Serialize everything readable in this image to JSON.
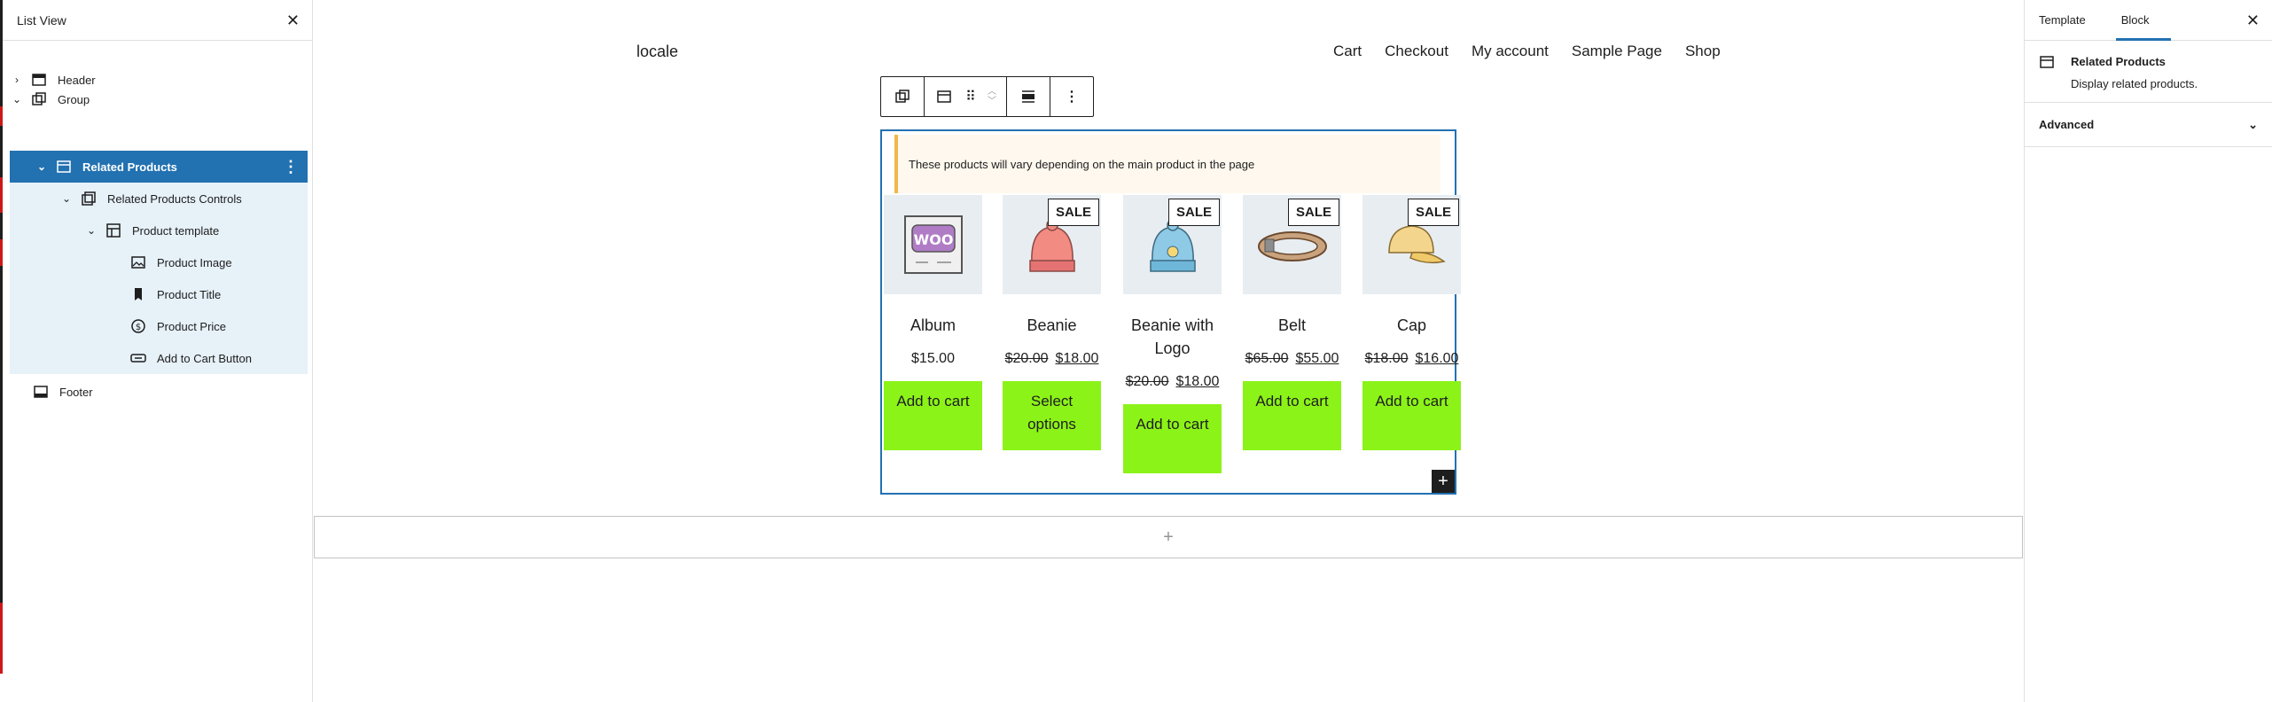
{
  "list_view": {
    "title": "List View",
    "close_icon": "close-icon",
    "items": [
      {
        "label": "Header",
        "icon": "template-part-icon",
        "chevron": "›"
      },
      {
        "label": "Group",
        "icon": "group-icon",
        "chevron": "⌄"
      },
      {
        "label": "Related Products",
        "icon": "related-products-icon",
        "chevron": "⌄"
      },
      {
        "label": "Related Products Controls",
        "icon": "controls-icon",
        "chevron": "⌄"
      },
      {
        "label": "Product template",
        "icon": "layout-icon",
        "chevron": "⌄"
      },
      {
        "label": "Product Image",
        "icon": "image-icon"
      },
      {
        "label": "Product Title",
        "icon": "bookmark-icon"
      },
      {
        "label": "Product Price",
        "icon": "currency-icon"
      },
      {
        "label": "Add to Cart Button",
        "icon": "button-icon"
      },
      {
        "label": "Footer",
        "icon": "footer-icon"
      }
    ]
  },
  "site": {
    "title": "locale",
    "nav": [
      "Cart",
      "Checkout",
      "My account",
      "Sample Page",
      "Shop"
    ]
  },
  "block": {
    "notice": "These products will vary depending on the main product in the page",
    "products": [
      {
        "title": "Album",
        "price": "$15.00",
        "old_price": "",
        "sale": "",
        "button": "Add to cart"
      },
      {
        "title": "Beanie",
        "price": "$18.00",
        "old_price": "$20.00",
        "sale": "SALE",
        "button": "Select options"
      },
      {
        "title": "Beanie with Logo",
        "price": "$18.00",
        "old_price": "$20.00",
        "sale": "SALE",
        "button": "Add to cart"
      },
      {
        "title": "Belt",
        "price": "$55.00",
        "old_price": "$65.00",
        "sale": "SALE",
        "button": "Add to cart"
      },
      {
        "title": "Cap",
        "price": "$16.00",
        "old_price": "$18.00",
        "sale": "SALE",
        "button": "Add to cart"
      }
    ]
  },
  "settings": {
    "tabs": [
      "Template",
      "Block"
    ],
    "active_tab": "Block",
    "block_name": "Related Products",
    "block_desc": "Display related products.",
    "advanced": "Advanced"
  },
  "colors": {
    "accent": "#2271b1",
    "button_green": "#8cf318",
    "notice_border": "#f0b849"
  }
}
